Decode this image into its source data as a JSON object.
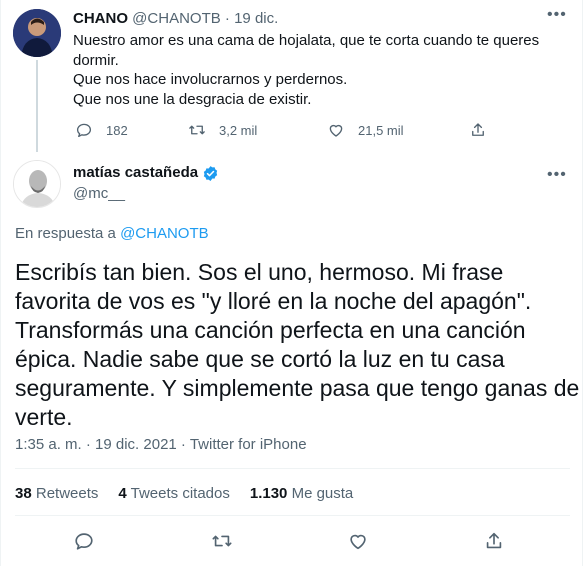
{
  "parent_tweet": {
    "author_name": "CHANO",
    "author_handle": "@CHANOTB",
    "date": "19 dic.",
    "separator": "·",
    "text_lines": [
      "Nuestro amor es una cama de hojalata, que te corta cuando te queres",
      "dormir.",
      "Que nos hace involucrarnos y perdernos.",
      "Que nos une la desgracia de existir."
    ],
    "replies": "182",
    "retweets": "3,2 mil",
    "likes": "21,5 mil",
    "icons": [
      "reply-icon",
      "retweet-icon",
      "like-icon",
      "share-icon",
      "more-icon"
    ]
  },
  "main_tweet": {
    "author_name": "matías castañeda",
    "author_handle": "@mc__",
    "reply_prefix": "En respuesta a",
    "reply_handle": "@CHANOTB",
    "text_lines": [
      "Escribís tan bien. Sos el uno, hermoso. Mi frase",
      "favorita de vos es \"y lloré en la noche del apagón\".",
      "Transformás una canción perfecta en una canción",
      "épica. Nadie sabe que se cortó la luz en tu casa",
      "seguramente. Y simplemente pasa que tengo ganas de",
      "verte."
    ],
    "timestamp": "1:35 a. m. · 19 dic. 2021 · Twitter for iPhone",
    "stats": [
      {
        "count": "38",
        "label": "Retweets"
      },
      {
        "count": "4",
        "label": "Tweets citados"
      },
      {
        "count": "1.130",
        "label": "Me gusta"
      }
    ],
    "icons": [
      "verified-badge-icon",
      "reply-icon",
      "retweet-icon",
      "like-icon",
      "share-icon",
      "more-icon"
    ]
  },
  "colors": {
    "accent": "#1d9bf0",
    "text": "#0f1419",
    "secondary": "#536471",
    "divider": "#eff3f4"
  },
  "more_glyph": "•••"
}
